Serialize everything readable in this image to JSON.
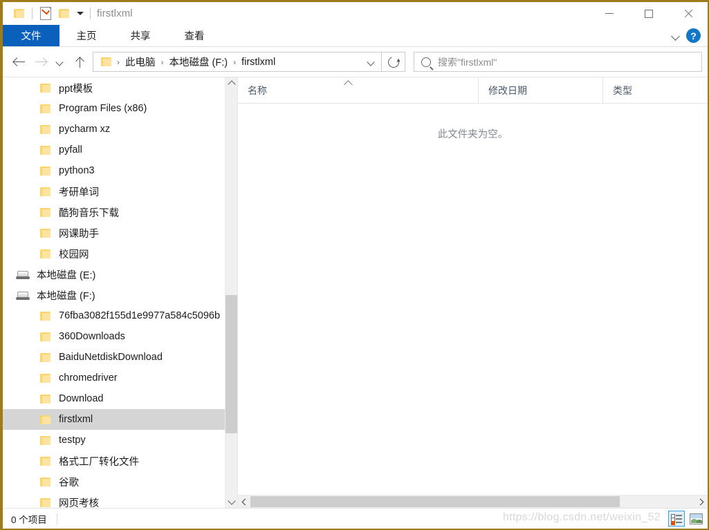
{
  "window": {
    "title": "firstlxml",
    "quick_access": [
      {
        "name": "folder-icon",
        "label": "文件夹"
      },
      {
        "name": "properties-icon",
        "label": "属性"
      },
      {
        "name": "new-folder-icon",
        "label": "新建文件夹"
      },
      {
        "name": "customize-caret-icon",
        "label": "自定义快速访问工具栏"
      }
    ],
    "controls": {
      "minimize": "最小化",
      "maximize": "最大化",
      "close": "关闭"
    }
  },
  "ribbon": {
    "tabs": [
      {
        "label": "文件",
        "active": true
      },
      {
        "label": "主页",
        "active": false
      },
      {
        "label": "共享",
        "active": false
      },
      {
        "label": "查看",
        "active": false
      }
    ],
    "expand_label": "展开功能区",
    "help_label": "?"
  },
  "address": {
    "back_label": "返回",
    "forward_label": "前进",
    "recent_label": "最近位置",
    "up_label": "上移到上一级",
    "breadcrumbs": [
      "此电脑",
      "本地磁盘 (F:)",
      "firstlxml"
    ],
    "separator": "›",
    "dropdown_label": "下拉",
    "refresh_label": "刷新"
  },
  "search": {
    "placeholder": "搜索\"firstlxml\"",
    "value": ""
  },
  "navigation": {
    "items": [
      {
        "label": "ppt模板",
        "icon": "folder-icon",
        "indent": 1,
        "selected": false
      },
      {
        "label": "Program Files (x86)",
        "icon": "folder-icon",
        "indent": 1,
        "selected": false
      },
      {
        "label": "pycharm xz",
        "icon": "folder-icon",
        "indent": 1,
        "selected": false
      },
      {
        "label": "pyfall",
        "icon": "folder-icon",
        "indent": 1,
        "selected": false
      },
      {
        "label": "python3",
        "icon": "folder-icon",
        "indent": 1,
        "selected": false
      },
      {
        "label": "考研单词",
        "icon": "folder-icon",
        "indent": 1,
        "selected": false
      },
      {
        "label": "酷狗音乐下载",
        "icon": "folder-icon",
        "indent": 1,
        "selected": false
      },
      {
        "label": "网课助手",
        "icon": "folder-icon",
        "indent": 1,
        "selected": false
      },
      {
        "label": "校园网",
        "icon": "folder-icon",
        "indent": 1,
        "selected": false
      },
      {
        "label": "本地磁盘 (E:)",
        "icon": "drive-icon",
        "indent": 0,
        "selected": false
      },
      {
        "label": "本地磁盘 (F:)",
        "icon": "drive-icon",
        "indent": 0,
        "selected": false
      },
      {
        "label": "76fba3082f155d1e9977a584c5096b",
        "icon": "folder-icon",
        "indent": 1,
        "selected": false
      },
      {
        "label": "360Downloads",
        "icon": "folder-icon",
        "indent": 1,
        "selected": false
      },
      {
        "label": "BaiduNetdiskDownload",
        "icon": "folder-icon",
        "indent": 1,
        "selected": false
      },
      {
        "label": "chromedriver",
        "icon": "folder-icon",
        "indent": 1,
        "selected": false
      },
      {
        "label": "Download",
        "icon": "folder-icon",
        "indent": 1,
        "selected": false
      },
      {
        "label": "firstlxml",
        "icon": "folder-icon",
        "indent": 1,
        "selected": true
      },
      {
        "label": "testpy",
        "icon": "folder-icon",
        "indent": 1,
        "selected": false
      },
      {
        "label": "格式工厂转化文件",
        "icon": "folder-icon",
        "indent": 1,
        "selected": false
      },
      {
        "label": "谷歌",
        "icon": "folder-icon",
        "indent": 1,
        "selected": false
      },
      {
        "label": "网页考核",
        "icon": "folder-icon",
        "indent": 1,
        "selected": false
      }
    ],
    "scroll_up_label": "向上滚动",
    "scroll_down_label": "向下滚动"
  },
  "filelist": {
    "columns": [
      {
        "label": "名称",
        "sorted": "asc"
      },
      {
        "label": "修改日期",
        "sorted": ""
      },
      {
        "label": "类型",
        "sorted": ""
      }
    ],
    "empty_message": "此文件夹为空。",
    "rows": [],
    "scroll_left_label": "向左滚动",
    "scroll_right_label": "向右滚动"
  },
  "statusbar": {
    "item_count": "0 个项目",
    "watermark": "https://blog.csdn.net/weixin_52",
    "views": [
      {
        "name": "details-view-button",
        "label": "详细信息",
        "active": true
      },
      {
        "name": "large-icons-view-button",
        "label": "大图标",
        "active": false
      }
    ]
  },
  "colors": {
    "accent": "#0b60bb",
    "window_border": "#9e7c1c",
    "selection": "#d5d5d5",
    "folder": "#fbd46a",
    "help_blue": "#1277c4"
  }
}
